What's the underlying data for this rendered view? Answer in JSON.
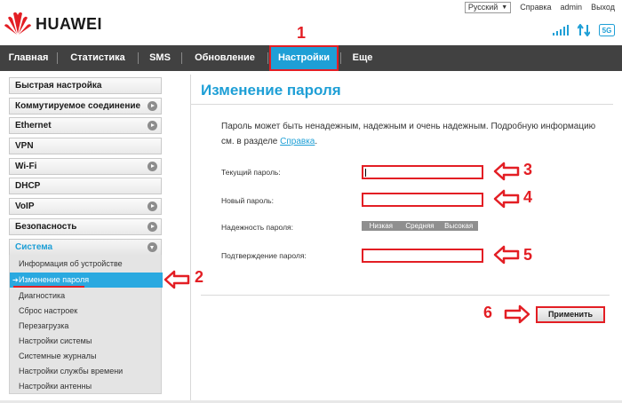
{
  "brand": "HUAWEI",
  "top_links": {
    "language": "Русский",
    "help": "Справка",
    "user": "admin",
    "logout": "Выход"
  },
  "status_icons": {
    "signal": "signal-icon",
    "transfer": "up-down-arrows-icon",
    "network": "5G",
    "network_icon": "network-type-icon"
  },
  "nav": {
    "items": [
      {
        "label": "Главная"
      },
      {
        "label": "Статистика"
      },
      {
        "label": "SMS"
      },
      {
        "label": "Обновление"
      },
      {
        "label": "Настройки",
        "active": true
      },
      {
        "label": "Еще"
      }
    ]
  },
  "sidebar": {
    "items": [
      {
        "label": "Быстрая настройка",
        "has_arrow": false
      },
      {
        "label": "Коммутируемое соединение",
        "has_arrow": true
      },
      {
        "label": "Ethernet",
        "has_arrow": true
      },
      {
        "label": "VPN",
        "has_arrow": false
      },
      {
        "label": "Wi-Fi",
        "has_arrow": true
      },
      {
        "label": "DHCP",
        "has_arrow": false
      },
      {
        "label": "VoIP",
        "has_arrow": true
      },
      {
        "label": "Безопасность",
        "has_arrow": true
      },
      {
        "label": "Система",
        "has_arrow": true,
        "open": true
      }
    ],
    "sub_items": [
      {
        "label": "Информация об устройстве"
      },
      {
        "label": "Изменение пароля",
        "active": true
      },
      {
        "label": "Диагностика"
      },
      {
        "label": "Сброс настроек"
      },
      {
        "label": "Перезагрузка"
      },
      {
        "label": "Настройки системы"
      },
      {
        "label": "Системные журналы"
      },
      {
        "label": "Настройки службы времени"
      },
      {
        "label": "Настройки антенны"
      }
    ]
  },
  "main": {
    "title": "Изменение пароля",
    "description_line1": "Пароль может быть ненадежным, надежным и очень надежным. Подробную информацию",
    "description_prefix": "см. в разделе ",
    "description_link": "Справка",
    "description_suffix": ".",
    "fields": {
      "current_label": "Текущий пароль:",
      "current_value": "",
      "new_label": "Новый пароль:",
      "new_value": "",
      "strength_label": "Надежность пароля:",
      "confirm_label": "Подтверждение пароля:",
      "confirm_value": ""
    },
    "strength_levels": [
      "Низкая",
      "Средняя",
      "Высокая"
    ],
    "apply_label": "Применить"
  },
  "annotations": {
    "step1": "1",
    "step2": "2",
    "step3": "3",
    "step4": "4",
    "step5": "5",
    "step6": "6"
  },
  "colors": {
    "accent": "#1e9fd6",
    "nav_bg": "#414141",
    "annotation_red": "#e31e24",
    "logo_red": "#e31e24"
  }
}
